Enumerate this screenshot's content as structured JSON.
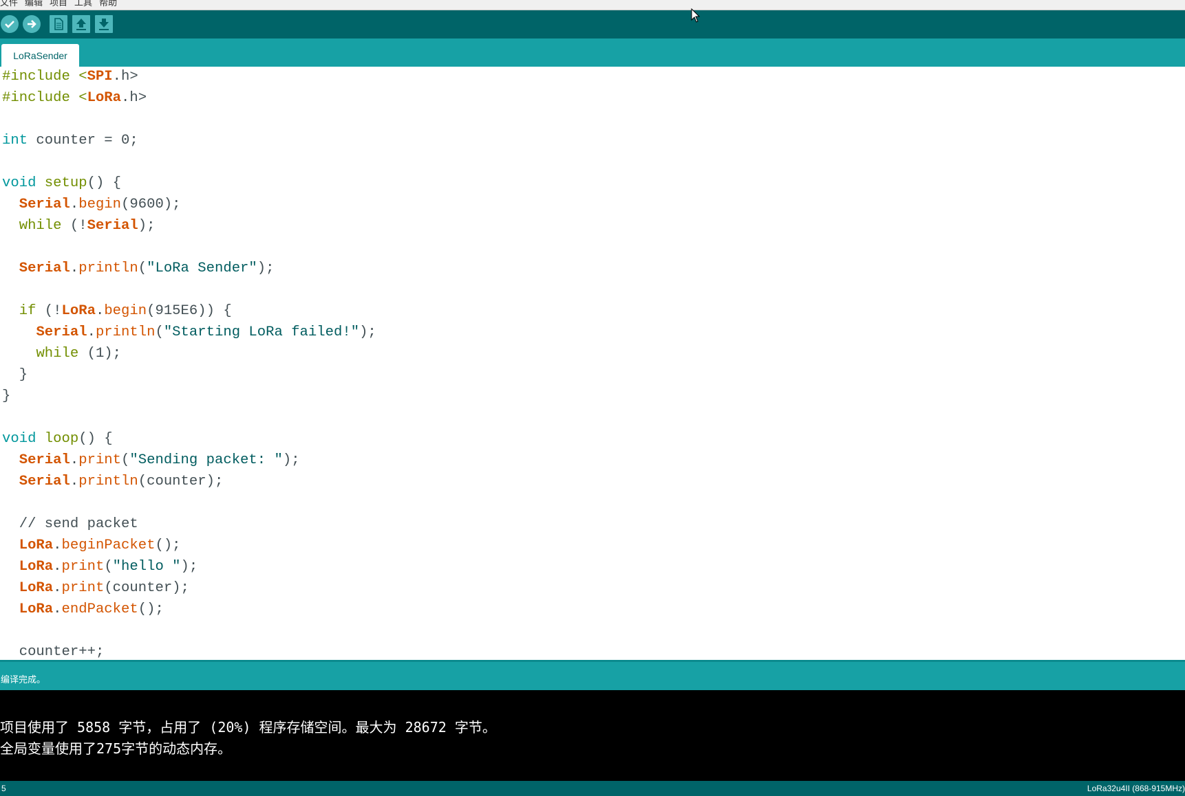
{
  "menu": [
    "文件",
    "编辑",
    "项目",
    "工具",
    "帮助"
  ],
  "toolbar": {
    "verify_icon": "check-icon",
    "upload_icon": "arrow-right-icon",
    "new_icon": "file-icon",
    "open_icon": "arrow-up-icon",
    "save_icon": "arrow-down-icon"
  },
  "tab": {
    "label": "LoRaSender"
  },
  "editor": {
    "lines": [
      [
        "#include <",
        "SPI",
        ".h>"
      ],
      [
        "#include <",
        "LoRa",
        ".h>"
      ],
      [],
      [
        "int",
        " counter = 0;"
      ],
      [],
      [
        "void",
        " ",
        "setup",
        "() {"
      ],
      [
        "  ",
        "Serial",
        ".",
        "begin",
        "(9600);"
      ],
      [
        "  ",
        "while",
        " (!",
        "Serial",
        ");"
      ],
      [],
      [
        "  ",
        "Serial",
        ".",
        "println",
        "(\"LoRa Sender\");"
      ],
      [],
      [
        "  ",
        "if",
        " (!",
        "LoRa",
        ".",
        "begin",
        "(915E6)) {"
      ],
      [
        "    ",
        "Serial",
        ".",
        "println",
        "(\"Starting LoRa failed!\");"
      ],
      [
        "    ",
        "while",
        " (1);"
      ],
      [
        "  }"
      ],
      [
        "}"
      ],
      [],
      [
        "void",
        " ",
        "loop",
        "() {"
      ],
      [
        "  ",
        "Serial",
        ".",
        "print",
        "(\"Sending packet: \");"
      ],
      [
        "  ",
        "Serial",
        ".",
        "println",
        "(counter);"
      ],
      [],
      [
        "  // send packet"
      ],
      [
        "  ",
        "LoRa",
        ".",
        "beginPacket",
        "();"
      ],
      [
        "  ",
        "LoRa",
        ".",
        "print",
        "(\"hello \");"
      ],
      [
        "  ",
        "LoRa",
        ".",
        "print",
        "(counter);"
      ],
      [
        "  ",
        "LoRa",
        ".",
        "endPacket",
        "();"
      ],
      [],
      [
        "  counter++;"
      ]
    ]
  },
  "status": {
    "message": "编译完成。"
  },
  "console": {
    "lines": [
      "项目使用了 5858 字节，占用了 (20%) 程序存储空间。最大为 28672 字节。",
      "全局变量使用了275字节的动态内存。"
    ]
  },
  "footer": {
    "line_number": "5",
    "board": "LoRa32u4II (868-915MHz)"
  },
  "colors": {
    "toolbar_bg": "#006468",
    "tab_bg": "#17a1a5",
    "button": "#4db7bb",
    "keyword": "#00979c",
    "class": "#d35400",
    "preprocessor": "#728e00"
  }
}
